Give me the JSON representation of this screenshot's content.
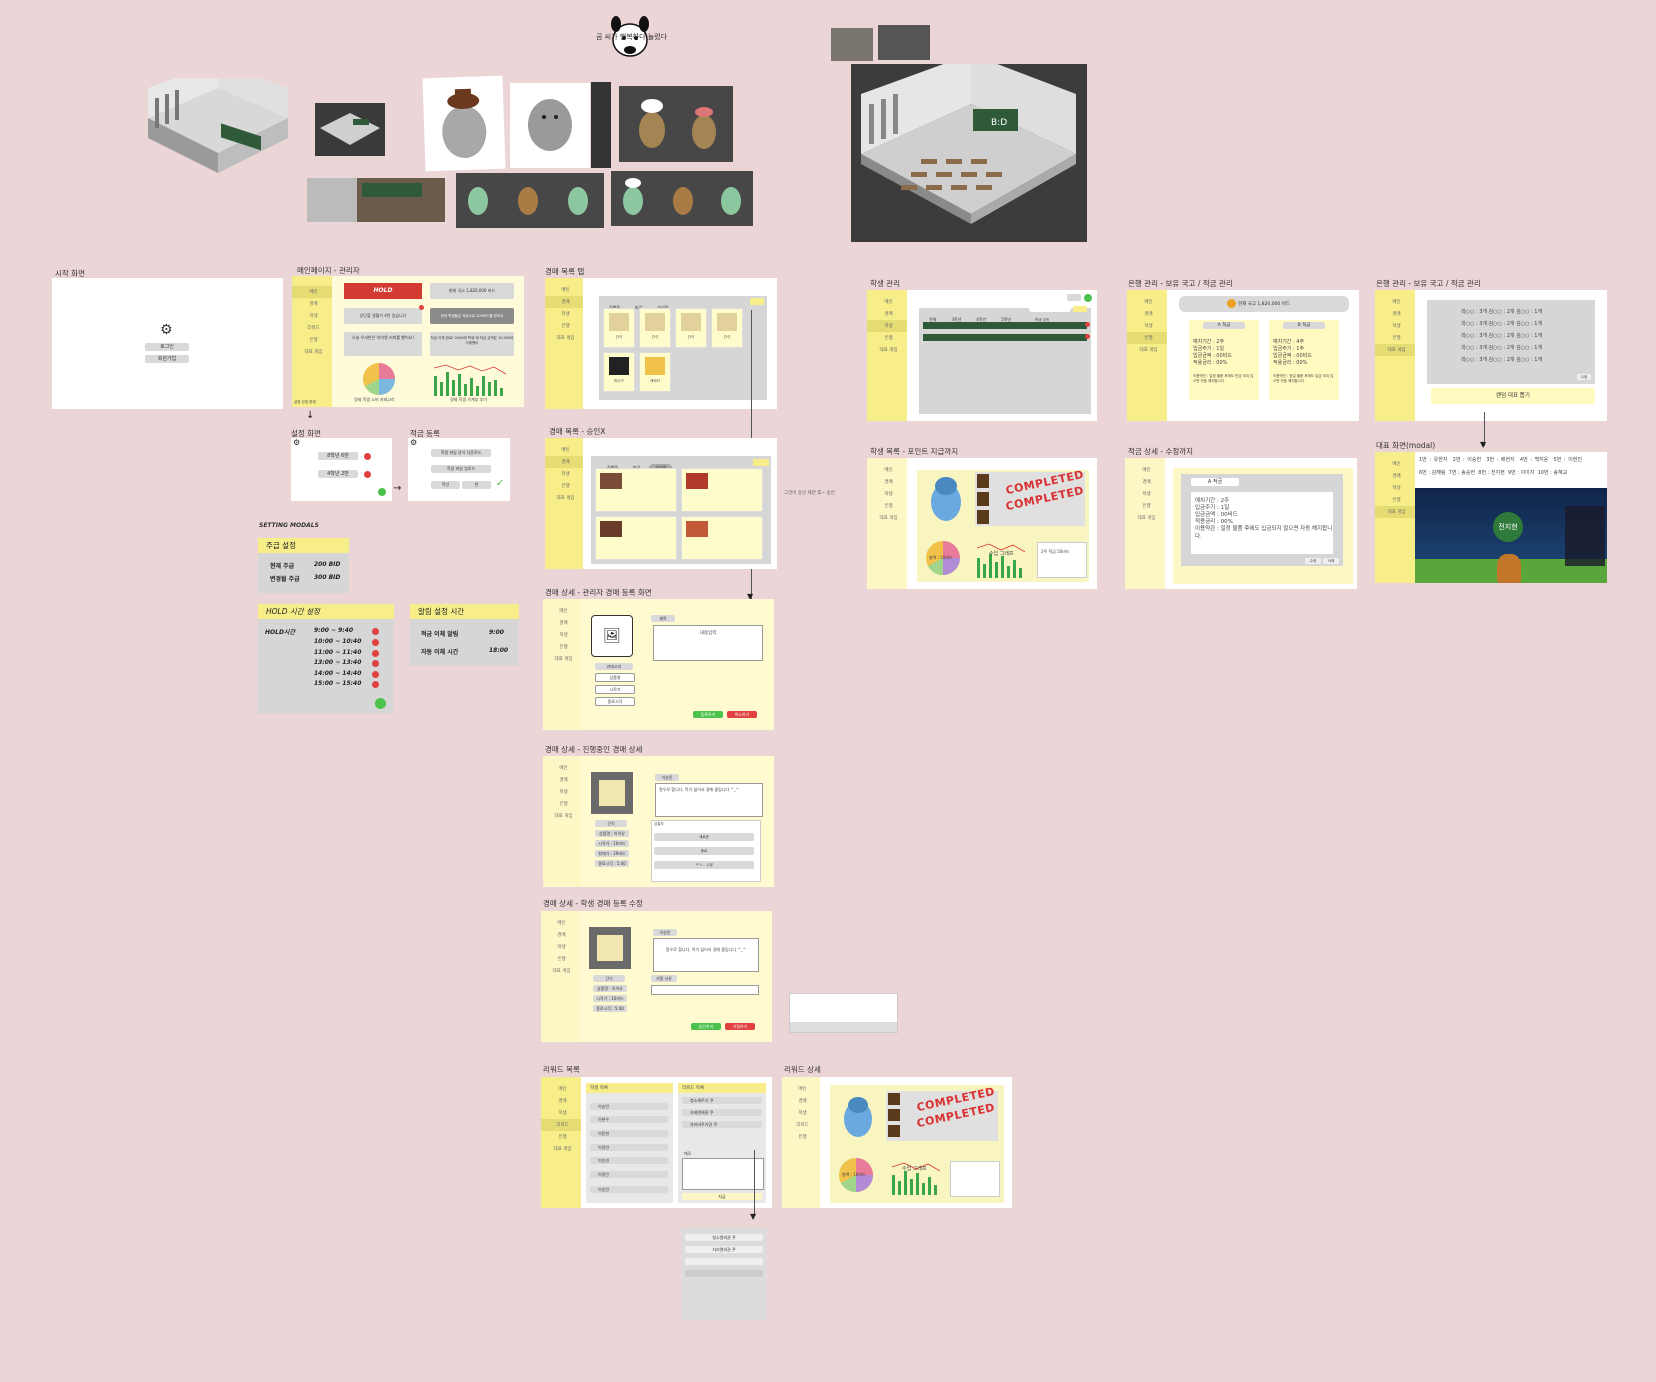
{
  "title_dog": "곰 씨가 행복하다 눌렀다",
  "labels": {
    "start": "시작 화면",
    "main_admin": "메인페이지 - 관리자",
    "settings": "설정 화면",
    "savings_reg": "적금 등록",
    "setting_modals": "SETTING MODALS",
    "auction_tab": "경매 목록 탭",
    "auction_approve": "경매 목록 - 승인X",
    "auction_detail_admin": "경매 상세 - 관리자 경매 등록 화면",
    "auction_detail_ongoing": "경매 상세 - 진행중인 경매 상세",
    "auction_detail_student": "경매 상세 - 학생 경매 등록 수정",
    "reward_list": "리워드 목록",
    "reward_detail": "리워드 상세",
    "student_mgmt": "학생 관리",
    "student_list": "학생 목록 - 포인트 지급까지",
    "bank1": "은행 관리 - 보유 국고 / 적금 관리",
    "bank_detail": "적금 상세 - 수정까지",
    "bank2": "은행 관리 - 보유 국고 / 적금 관리",
    "rep_modal": "대표 화면(modal)"
  },
  "start": {
    "login": "로그인",
    "signup": "회원가입"
  },
  "main": {
    "hold": "HOLD",
    "treasury": "현재 국고 1,820,000 비드",
    "tile1": "상단할 생활기 4번 있습니다",
    "tile2": "현재 학생들은 적금으로 200비드를 받아요",
    "tile3": "오늘 우리반은 아이엔 커피를 했어요!",
    "tile4": "적금 이체 완료! 0000에 학생 때 적금 금액은 10,000비 이체했어",
    "pie_caption": "경제 학생 소비 카테고리",
    "bar_caption": "경제 학생 가계부 추이",
    "sidebar": [
      "메인",
      "경매",
      "학생",
      "리워드",
      "은행",
      "대표 게임"
    ],
    "footer": "설정 산업 현재"
  },
  "settings": {
    "row1": "8학년 6반",
    "row2": "4학년 2반"
  },
  "savings": {
    "b1": "학생 파일 양식 다운로드",
    "b2": "학생 파일 업로드",
    "b3a": "학년",
    "b3b": "반"
  },
  "weekly": {
    "title": "주급 설정",
    "rows": [
      [
        "현재 주급",
        "200 BID"
      ],
      [
        "변경될 주급",
        "300 BID"
      ]
    ]
  },
  "hold": {
    "title": "HOLD 시간 설정",
    "label": "HOLD시간",
    "times": [
      "9:00 ~ 9:40",
      "10:00 ~ 10:40",
      "11:00 ~ 11:40",
      "13:00 ~ 13:40",
      "14:00 ~ 14:40",
      "15:00 ~ 15:40"
    ]
  },
  "alarm": {
    "title": "알림 설정 시간",
    "rows": [
      [
        "적금 이체 알림",
        "9:00"
      ],
      [
        "자동 이체 시간",
        "18:00"
      ]
    ]
  },
  "auction": {
    "tabs": [
      "진행중",
      "마감",
      "승인전"
    ],
    "items": [
      "간식",
      "간식",
      "간식",
      "간식",
      "마이구",
      "캐릭터"
    ],
    "approve_note": "그것이 승인 제한 후~ 승인",
    "desc_title": "제목",
    "desc": "내용입력",
    "category": "카테고리",
    "fields": [
      "상품명",
      "시작가",
      "종료시각"
    ],
    "register": "등록하기",
    "cancel": "취소하기",
    "ongoing_name": "이승민",
    "ongoing_desc": "알우로 합니다, 먹기 싫어서 경매 올립니다 ^_^",
    "ongoing_fields": [
      "간식",
      "상품명 : 아이유",
      "시작가 : 10비드",
      "현재가 : 29비드",
      "종료시각 : 5:40"
    ],
    "bids": [
      "입찰자",
      "새로운",
      "종료",
      "ㅋㅋ... 수정"
    ],
    "student_desc": "알우로 합니다, 먹기 싫어서 경매 올립니다 ^_^",
    "student_name": "이승민",
    "reject_label": "거절 사유",
    "approve": "승인하기",
    "reject": "거절하기"
  },
  "reward": {
    "col1": "학생 목록",
    "col2": "리워드 목록",
    "students": [
      "이승민",
      "이현우",
      "이동현",
      "이정연",
      "이승연",
      "이정민",
      "이승민"
    ],
    "rewards": [
      "청소해주기 쿠",
      "숙제면제권 쿠",
      "자리바꾸기권 쿠"
    ],
    "memo": "메모",
    "give": "지급",
    "popup": [
      "청소열외권 쿠",
      "자리열외권 쿠"
    ]
  },
  "reward_detail": {
    "completed": "COMPLETED",
    "pie_label": "총액 : 10비드",
    "bar_label": "수입 그래프"
  },
  "student": {
    "tabs": [
      "전체",
      "3학년",
      "4학년",
      "5학년"
    ],
    "search": "학생 검색",
    "add": "추가",
    "completed": "COMPLETED",
    "pie": "총액 : 10비드",
    "bar": "수입 그래프",
    "info": "2주 적금 50비드"
  },
  "bank": {
    "treasury": "현재 국고 1,820,000 비드",
    "a_title": "A 적금",
    "a": [
      "예치기간 : 2주",
      "입금주기 : 1일",
      "입금금액 : 00비드",
      "적용금리 : 00%"
    ],
    "a_note": "이용약관 : 일정 물품 후에도 만금 되지 않으면 자동 해지합니다",
    "b_title": "B 적금",
    "b": [
      "예치기간 : 4주",
      "입금주기 : 1주",
      "입금금액 : 00비드",
      "적용금리 : 00%"
    ],
    "b_note": "이용약관 : 정일 물품 후에도 입금 되지 않으면 자동 해지합니다",
    "detail_title": "A 적금",
    "detail": [
      "예치기간 : 2주",
      "입금주기 : 1일",
      "입금금액 : 00비드",
      "적용금리 : 00%",
      "이용약관 : 일정 물품 후에도 입금되지 않으면 자동 해지합니다."
    ],
    "rows": [
      "곽○○ : 3개  김○○ : 2개  김○○ : 1개",
      "곽○○ : 3개  김○○ : 2개  김○○ : 1개",
      "곽○○ : 3개  김○○ : 2개  김○○ : 1개",
      "곽○○ : 3개  김○○ : 2개  김○○ : 1개",
      "곽○○ : 3개  김○○ : 2개  김○○ : 1개"
    ],
    "random": "랜덤 대표 뽑기",
    "edit": "수정",
    "delete": "삭제"
  },
  "rep": {
    "row1": [
      "1번 : 유한지",
      "2번 : 이승헌",
      "3번 : 배현지",
      "4번 : 백지윤",
      "5번 : 이현진"
    ],
    "row2": [
      "6번 : 김해림",
      "7번 : 송승헌",
      "8번 : 전지현",
      "9번 : 이이지",
      "10번 : 송혜교"
    ],
    "picked": "전지현"
  },
  "classroom": {
    "board": "B:D"
  }
}
